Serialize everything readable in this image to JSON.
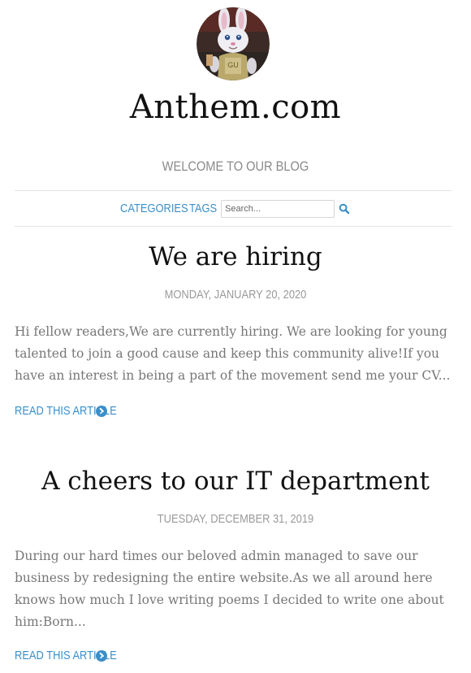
{
  "site": {
    "title": "Anthem.com",
    "tagline": "WELCOME TO OUR BLOG",
    "avatar_icon": "bunny-avatar"
  },
  "nav": {
    "categories_label": "CATEGORIES",
    "tags_label": "TAGS",
    "search_placeholder": "Search...",
    "search_icon": "search-icon"
  },
  "posts": [
    {
      "title": "We are hiring",
      "date": "MONDAY, JANUARY 20, 2020",
      "excerpt": "Hi fellow readers,We are currently hiring. We are looking for young talented to join a good cause and keep this community alive!If you have an interest in being a part of the movement send me your CV...",
      "read_more_label": "READ THIS ARTICLE"
    },
    {
      "title": "A cheers to our IT department",
      "date": "TUESDAY, DECEMBER 31, 2019",
      "excerpt": "During our hard times our beloved admin managed to save our business by redesigning the entire website.As we all around here knows how much I love writing poems I decided to write one about him:Born...",
      "read_more_label": "READ THIS ARTICLE"
    }
  ],
  "colors": {
    "link": "#3a8fc9",
    "muted": "#9a9a9a",
    "excerpt": "#777777",
    "title": "#111111"
  }
}
